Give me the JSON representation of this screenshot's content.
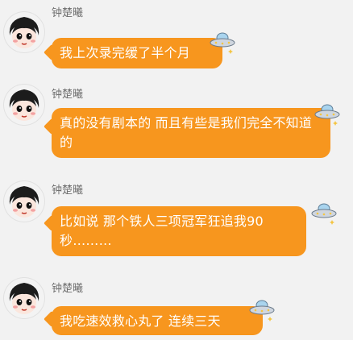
{
  "messages": [
    {
      "sender": "钟楚曦",
      "text": "我上次录完缓了半个月",
      "avatar_icon": "avatar-cartoon-icon",
      "badge_icon": "ufo-icon"
    },
    {
      "sender": "钟楚曦",
      "text": "真的没有剧本的 而且有些是我们完全不知道的",
      "avatar_icon": "avatar-cartoon-icon",
      "badge_icon": "ufo-icon"
    },
    {
      "sender": "钟楚曦",
      "text": "比如说 那个铁人三项冠军狂追我90秒………",
      "avatar_icon": "avatar-cartoon-icon",
      "badge_icon": "ufo-icon"
    },
    {
      "sender": "钟楚曦",
      "text": "我吃速效救心丸了 连续三天",
      "avatar_icon": "avatar-cartoon-icon",
      "badge_icon": "ufo-icon"
    }
  ],
  "colors": {
    "bubble": "#f7961e",
    "bubble_text": "#ffffff",
    "background": "#f2f2f2",
    "name_text": "#6f6f6f"
  }
}
